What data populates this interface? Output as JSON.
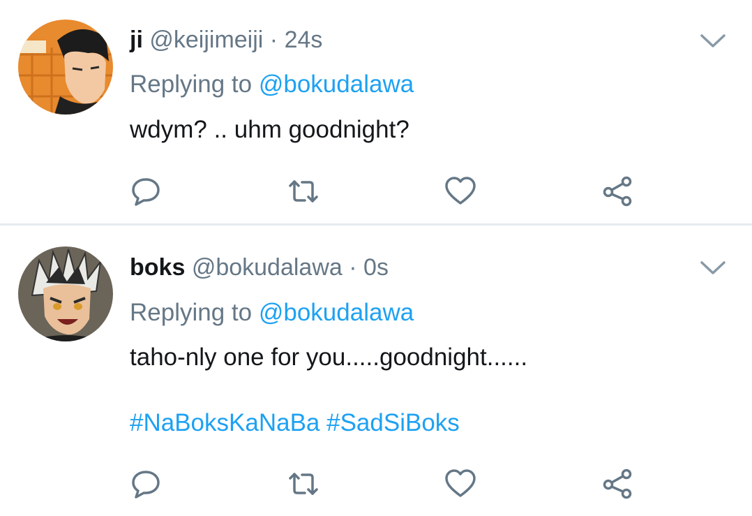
{
  "tweets": [
    {
      "display_name": "ji",
      "handle": "@keijimeiji",
      "separator": "·",
      "time": "24s",
      "replying_prefix": "Replying to",
      "replying_to": "@bokudalawa",
      "text": "wdym? .. uhm goodnight?",
      "avatar_icon": "anime-avatar-dark-hair",
      "hashtags": []
    },
    {
      "display_name": "boks",
      "handle": "@bokudalawa",
      "separator": "·",
      "time": "0s",
      "replying_prefix": "Replying to",
      "replying_to": "@bokudalawa",
      "text": "taho-nly one for you.....goodnight......",
      "avatar_icon": "anime-avatar-spiky-hair",
      "hashtags": [
        "#NaBoksKaNaBa",
        "#SadSiBoks"
      ]
    }
  ],
  "actions": [
    "reply-icon",
    "retweet-icon",
    "like-icon",
    "share-icon"
  ],
  "colors": {
    "link": "#1da1f2",
    "muted": "#657786",
    "text": "#14171a",
    "icon": "#657786",
    "divider": "#e6ecf0"
  }
}
